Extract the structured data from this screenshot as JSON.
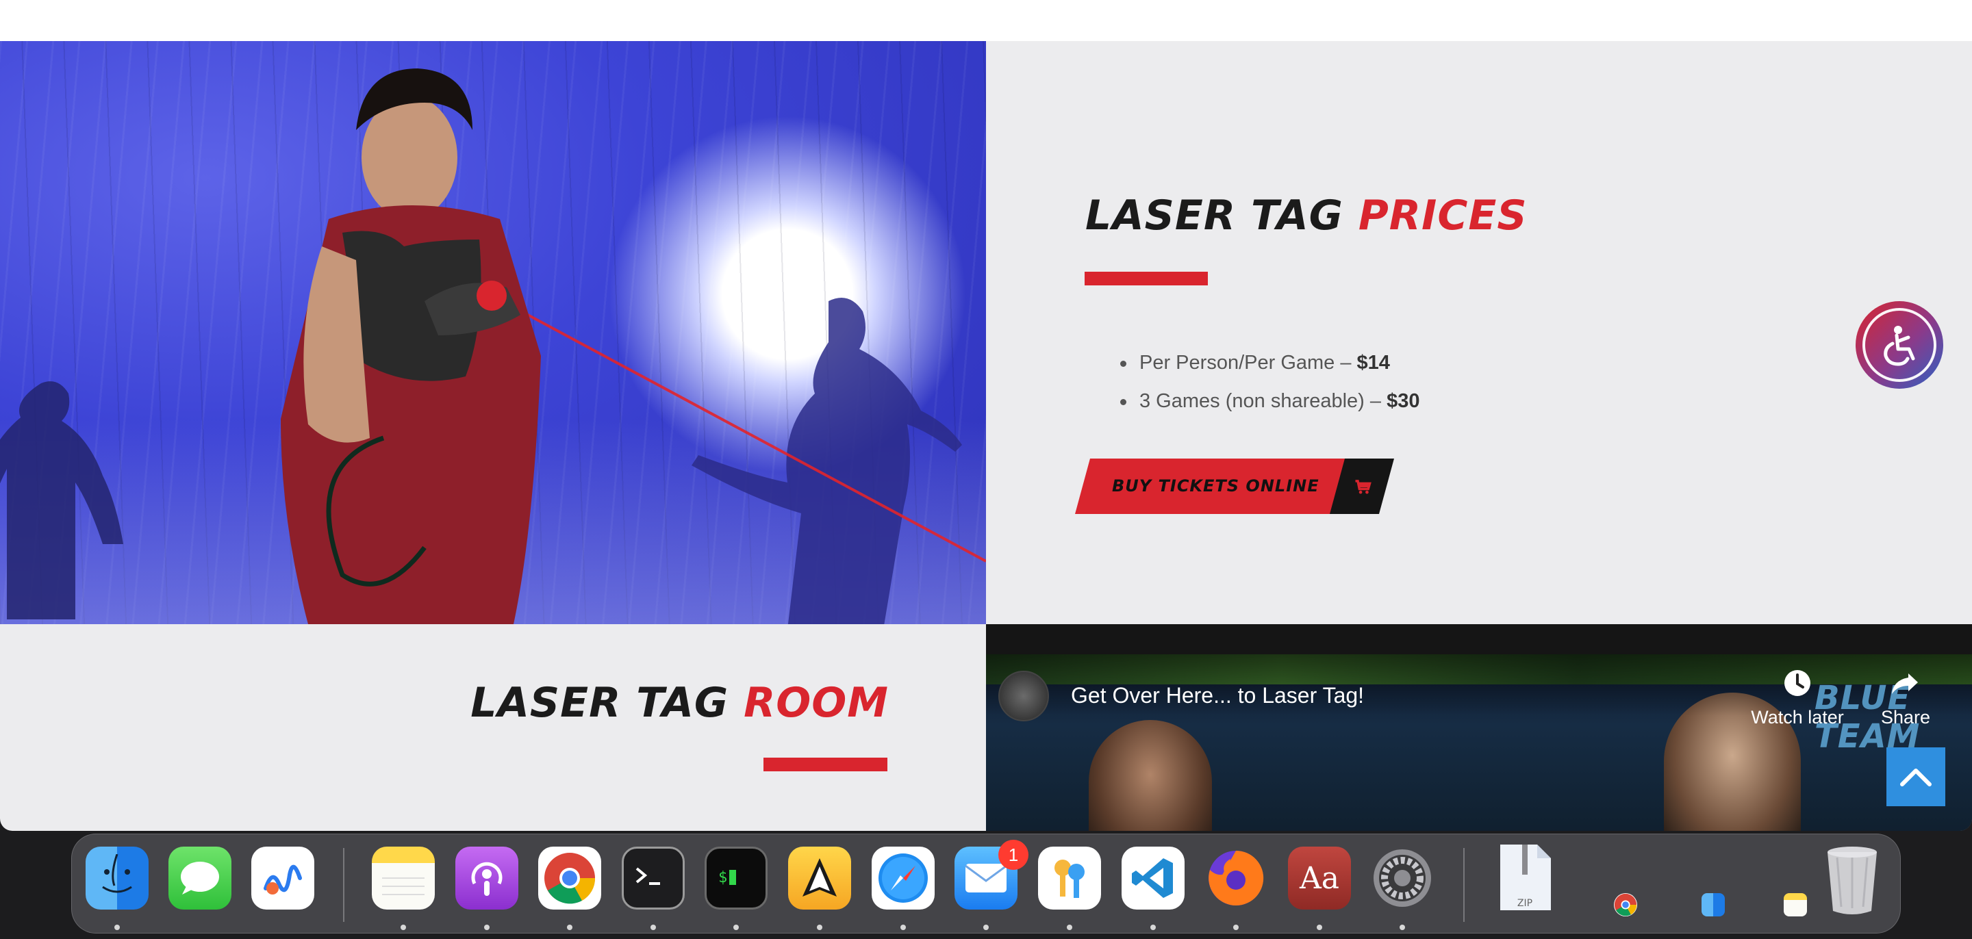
{
  "prices": {
    "title_main": "LASER TAG",
    "title_accent": "PRICES",
    "items": [
      {
        "label": "Per Person/Per Game – ",
        "amount": "$14"
      },
      {
        "label": "3 Games (non shareable) – ",
        "amount": "$30"
      }
    ],
    "buy_label": "BUY TICKETS ONLINE"
  },
  "room": {
    "title_main": "LASER TAG",
    "title_accent": "ROOM"
  },
  "video": {
    "title": "Get Over Here... to Laser Tag!",
    "watch_later": "Watch later",
    "share": "Share",
    "overlay_text": "BLUE TEAM"
  },
  "dock": {
    "items": [
      "Finder",
      "Messages",
      "Freeform",
      "Notes",
      "Podcasts",
      "Google Chrome",
      "Terminal",
      "iTerm",
      "Vectorize",
      "Safari",
      "Mail",
      "Keychain Access",
      "Visual Studio Code",
      "Firefox",
      "Dictionary",
      "System Settings",
      "Archive Utility"
    ],
    "mail_badge": "1",
    "dictionary_label": "Aa",
    "zip_label": "ZIP"
  },
  "colors": {
    "accent_red": "#d9252e",
    "scroll_top_blue": "#2f8fdf"
  }
}
